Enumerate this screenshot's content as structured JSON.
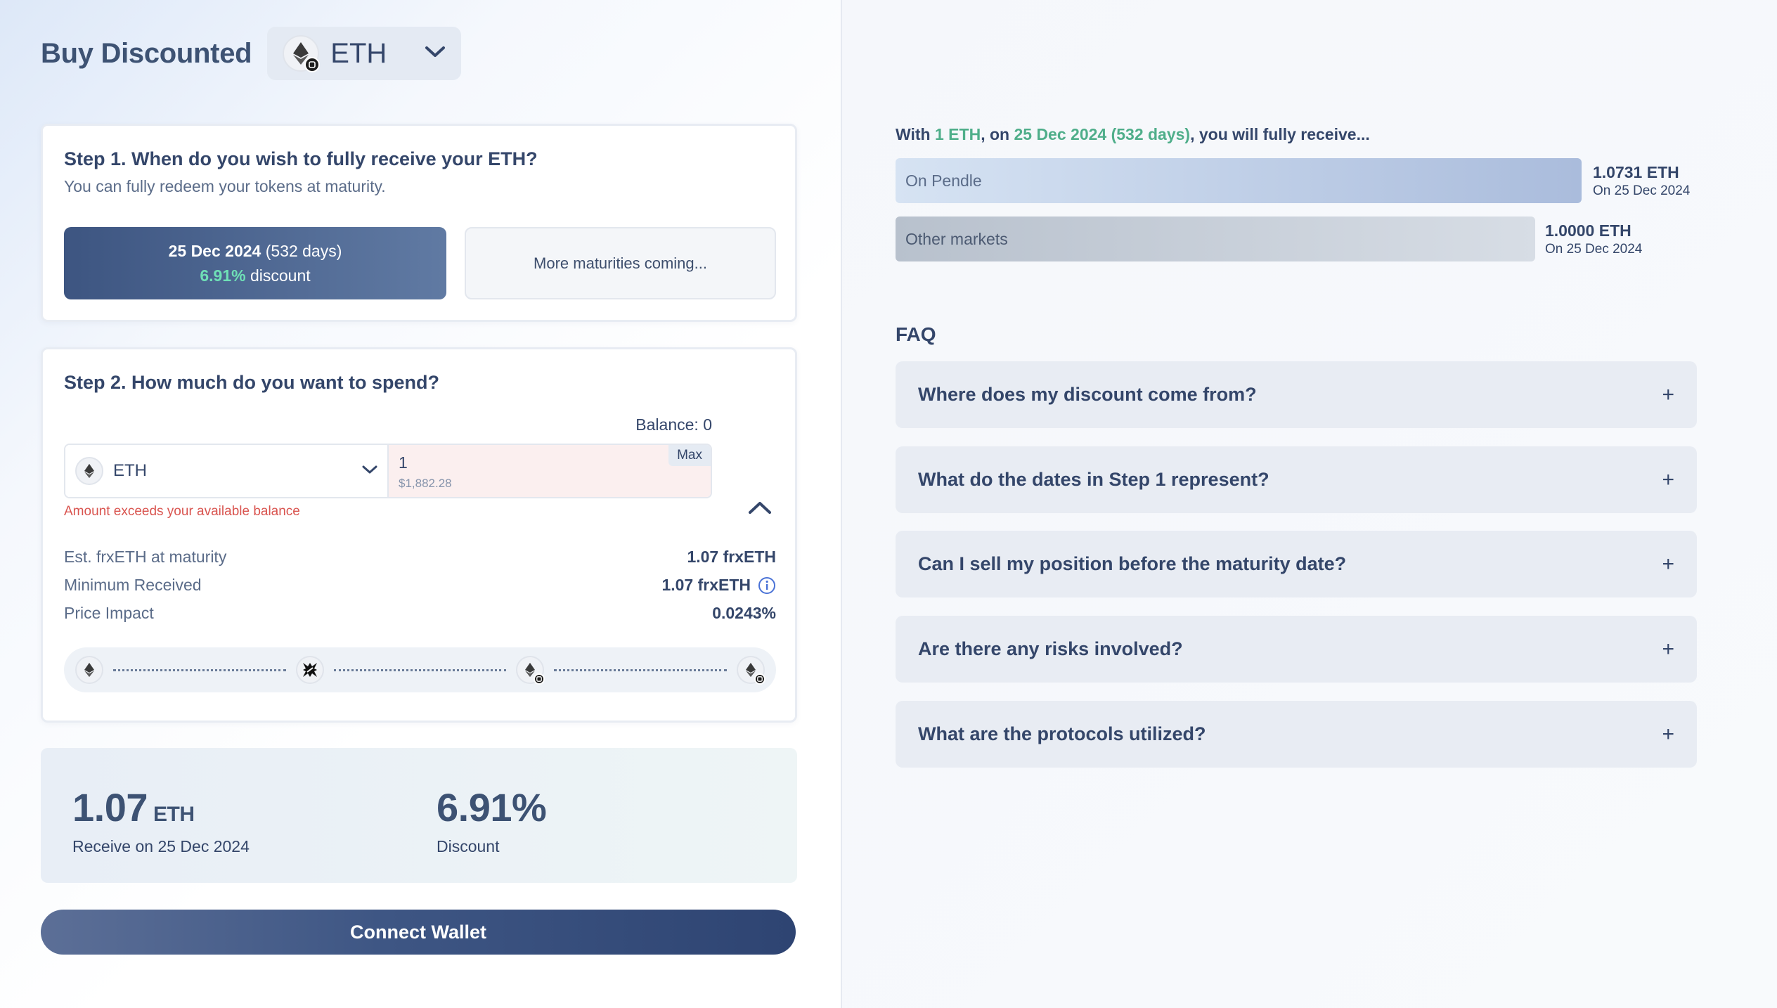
{
  "header": {
    "title": "Buy Discounted",
    "token": "ETH"
  },
  "step1": {
    "title": "Step 1. When do you wish to fully receive your ETH?",
    "subtitle": "You can fully redeem your tokens at maturity.",
    "selected_maturity": {
      "date": "25 Dec 2024",
      "days": "(532 days)",
      "discount_value": "6.91%",
      "discount_label": "discount"
    },
    "more_label": "More maturities coming..."
  },
  "step2": {
    "title": "Step 2. How much do you want to spend?",
    "balance": "Balance: 0",
    "token": "ETH",
    "amount": "1",
    "amount_usd": "$1,882.28",
    "max_label": "Max",
    "error": "Amount exceeds your available balance",
    "stats": [
      {
        "label": "Est. frxETH at maturity",
        "value": "1.07 frxETH"
      },
      {
        "label": "Minimum Received",
        "value": "1.07 frxETH"
      },
      {
        "label": "Price Impact",
        "value": "0.0243%"
      }
    ],
    "route_icons": [
      "eth-icon",
      "frax-icon",
      "pendle-eth-icon",
      "pendle-eth-icon"
    ]
  },
  "summary": {
    "amount": "1.07",
    "unit": "ETH",
    "amount_label": "Receive on 25 Dec 2024",
    "discount": "6.91%",
    "discount_label": "Discount"
  },
  "connect_label": "Connect Wallet",
  "receive": {
    "prefix": "With ",
    "amount": "1 ETH",
    "mid": ", on ",
    "date": "25 Dec 2024 (532 days)",
    "suffix": ", you will fully receive...",
    "bars": [
      {
        "label": "On Pendle",
        "value": "1.0731 ETH",
        "date": "On 25 Dec 2024"
      },
      {
        "label": "Other markets",
        "value": "1.0000 ETH",
        "date": "On 25 Dec 2024"
      }
    ]
  },
  "faq": {
    "title": "FAQ",
    "items": [
      "Where does my discount come from?",
      "What do the dates in Step 1 represent?",
      "Can I sell my position before the maturity date?",
      "Are there any risks involved?",
      "What are the protocols utilized?"
    ]
  },
  "colors": {
    "accent_green": "#4fae8a",
    "primary_navy": "#34466a",
    "error_red": "#d9544f"
  }
}
